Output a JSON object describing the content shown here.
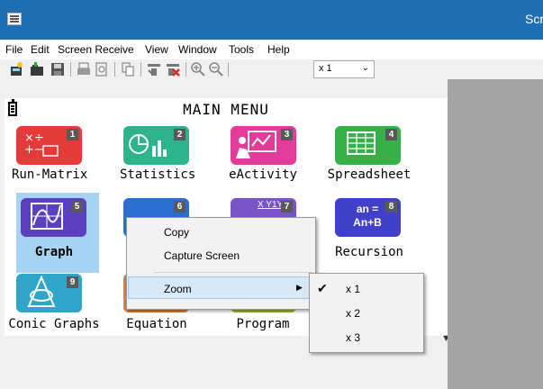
{
  "window": {
    "title": "Scr"
  },
  "menu": [
    "File",
    "Edit",
    "Screen Receive",
    "View",
    "Window",
    "Tools",
    "Help"
  ],
  "toolbar": {
    "icons": [
      "new-icon",
      "open-icon",
      "save-icon",
      "print-icon",
      "print-preview-icon",
      "copy-icon",
      "receive-icon",
      "stop-receive-icon",
      "zoom-in-icon",
      "zoom-out-icon"
    ],
    "zoom_value": "x 1"
  },
  "screen": {
    "title": "MAIN MENU",
    "apps": [
      {
        "num": "1",
        "label": "Run-Matrix",
        "color": "#e23b39",
        "glyph": "×÷ +− [88]"
      },
      {
        "num": "2",
        "label": "Statistics",
        "color": "#2fb38c",
        "glyph": "stats"
      },
      {
        "num": "3",
        "label": "eActivity",
        "color": "#e23b9a",
        "glyph": "eact"
      },
      {
        "num": "4",
        "label": "Spreadsheet",
        "color": "#38b04a",
        "glyph": "sheet"
      },
      {
        "num": "5",
        "label": "Graph",
        "color": "#5a3fbf",
        "glyph": "graph"
      },
      {
        "num": "6",
        "label": "",
        "color": "#2b6ed1",
        "glyph": ""
      },
      {
        "num": "7",
        "label": "",
        "color": "#7a55c7",
        "glyph": "X Y1Y2"
      },
      {
        "num": "8",
        "label": "Recursion",
        "color": "#4040c8",
        "glyph": "an = An+B"
      },
      {
        "num": "9",
        "label": "Conic Graphs",
        "color": "#2fa6c8",
        "glyph": "conic"
      },
      {
        "num": "",
        "label": "Equation",
        "color": "#e07a2e",
        "glyph": ""
      },
      {
        "num": "",
        "label": "Program",
        "color": "#9bb52e",
        "glyph": ""
      },
      {
        "num": "",
        "label": "",
        "color": "#cbb936",
        "glyph": ""
      }
    ]
  },
  "context_menu": {
    "items": [
      "Copy",
      "Capture Screen",
      "Zoom"
    ],
    "zoom_options": [
      "x 1",
      "x 2",
      "x 3"
    ],
    "zoom_selected": "x 1"
  }
}
